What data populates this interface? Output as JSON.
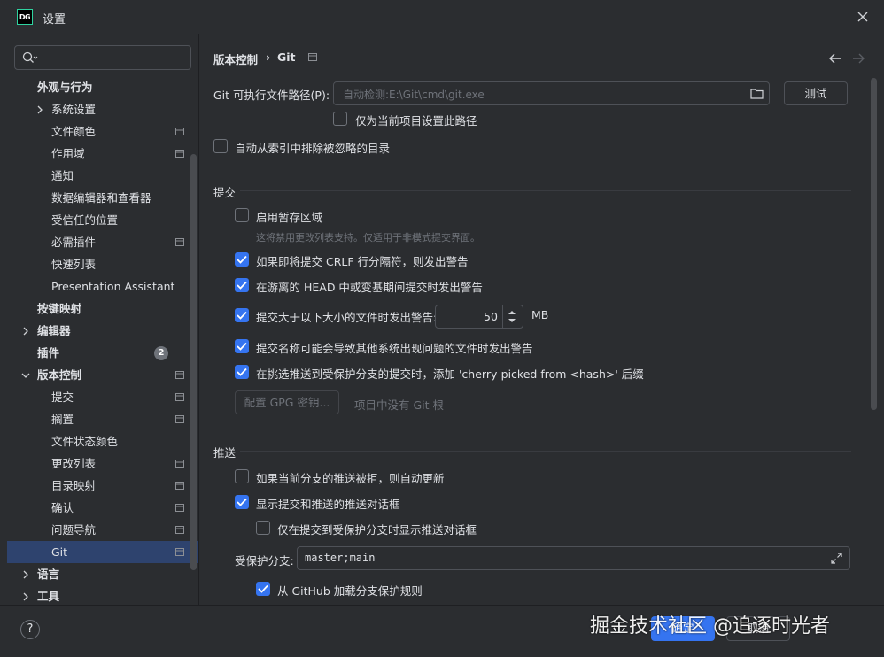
{
  "window": {
    "title": "设置",
    "app_icon_text": "DG"
  },
  "sidebar": {
    "search_placeholder": "",
    "items": [
      {
        "label": "外观与行为",
        "bold": true
      },
      {
        "label": "系统设置"
      },
      {
        "label": "文件颜色"
      },
      {
        "label": "作用域"
      },
      {
        "label": "通知"
      },
      {
        "label": "数据编辑器和查看器"
      },
      {
        "label": "受信任的位置"
      },
      {
        "label": "必需插件"
      },
      {
        "label": "快速列表"
      },
      {
        "label": "Presentation Assistant"
      },
      {
        "label": "按键映射",
        "bold": true
      },
      {
        "label": "编辑器",
        "bold": true
      },
      {
        "label": "插件",
        "bold": true,
        "badge": "2"
      },
      {
        "label": "版本控制",
        "bold": true
      },
      {
        "label": "提交"
      },
      {
        "label": "搁置"
      },
      {
        "label": "文件状态颜色"
      },
      {
        "label": "更改列表"
      },
      {
        "label": "目录映射"
      },
      {
        "label": "确认"
      },
      {
        "label": "问题导航"
      },
      {
        "label": "Git",
        "selected": true
      },
      {
        "label": "语言",
        "bold": true
      },
      {
        "label": "工具",
        "bold": true
      }
    ]
  },
  "header": {
    "crumb_parent": "版本控制",
    "crumb_sep": "›",
    "crumb_current": "Git"
  },
  "git_path": {
    "label": "Git 可执行文件路径(P):",
    "placeholder": "自动检测:E:\\Git\\cmd\\git.exe",
    "test_button": "测试",
    "project_only": "仅为当前项目设置此路径",
    "auto_exclude": "自动从索引中排除被忽略的目录"
  },
  "commit": {
    "section": "提交",
    "staging": "启用暂存区域",
    "staging_hint": "这将禁用更改列表支持。仅适用于非模式提交界面。",
    "crlf": "如果即将提交 CRLF 行分隔符，则发出警告",
    "detached": "在游离的 HEAD 中或变基期间提交时发出警告",
    "large_files": "提交大于以下大小的文件时发出警告:",
    "size_value": "50",
    "size_unit": "MB",
    "bad_names": "提交名称可能会导致其他系统出现问题的文件时发出警告",
    "cherry_pick": "在挑选推送到受保护分支的提交时，添加 'cherry-picked from <hash>' 后缀",
    "gpg_button": "配置 GPG 密钥...",
    "no_git_root": "项目中没有 Git 根"
  },
  "push": {
    "section": "推送",
    "auto_update": "如果当前分支的推送被拒，则自动更新",
    "show_dialog": "显示提交和推送的推送对话框",
    "protected_only": "仅在提交到受保护分支时显示推送对话框",
    "protected_label": "受保护分支:",
    "protected_value": "master;main",
    "github_rules": "从 GitHub 加载分支保护规则"
  },
  "footer": {
    "help": "?",
    "ok": "确定",
    "cancel": "取消",
    "watermark": "掘金技术社区 @追逐时光者"
  }
}
